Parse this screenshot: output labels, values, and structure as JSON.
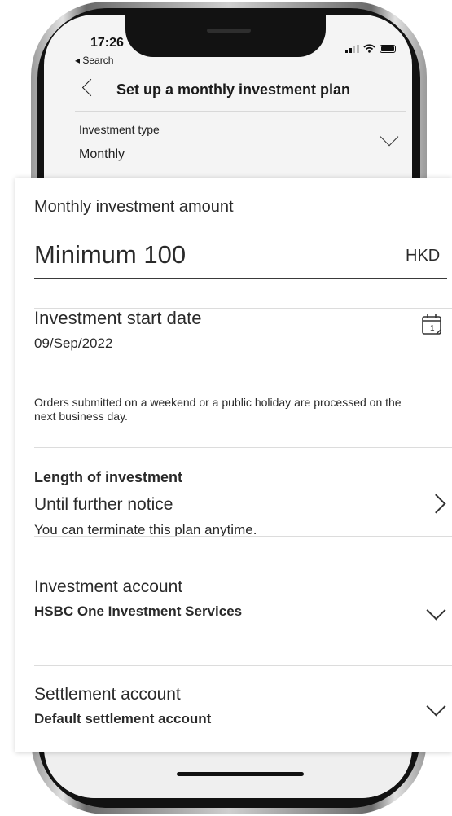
{
  "status_bar": {
    "time": "17:26",
    "back_label": "◂ Search"
  },
  "header": {
    "title": "Set up a monthly investment plan"
  },
  "investment_type": {
    "label": "Investment type",
    "value": "Monthly"
  },
  "amount": {
    "label": "Monthly investment amount",
    "placeholder": "Minimum 100",
    "currency": "HKD"
  },
  "start_date": {
    "label": "Investment start date",
    "value": "09/Sep/2022",
    "note": "Orders submitted on a weekend or a public holiday are processed on the next business day."
  },
  "length": {
    "label": "Length of investment",
    "value": "Until further notice",
    "note": "You can terminate this plan anytime."
  },
  "investment_account": {
    "label": "Investment account",
    "value": "HSBC One Investment Services"
  },
  "settlement_account": {
    "label": "Settlement account",
    "value": "Default settlement account"
  },
  "icons": {
    "back": "chevron-left-icon",
    "type_dropdown": "chevron-down-icon",
    "calendar": "calendar-icon",
    "length_next": "chevron-right-icon",
    "account_dropdown": "chevron-down-icon",
    "settlement_dropdown": "chevron-down-icon"
  },
  "colors": {
    "text": "#2a2a2a",
    "divider": "#dcdcdc",
    "frame": "#121212"
  }
}
